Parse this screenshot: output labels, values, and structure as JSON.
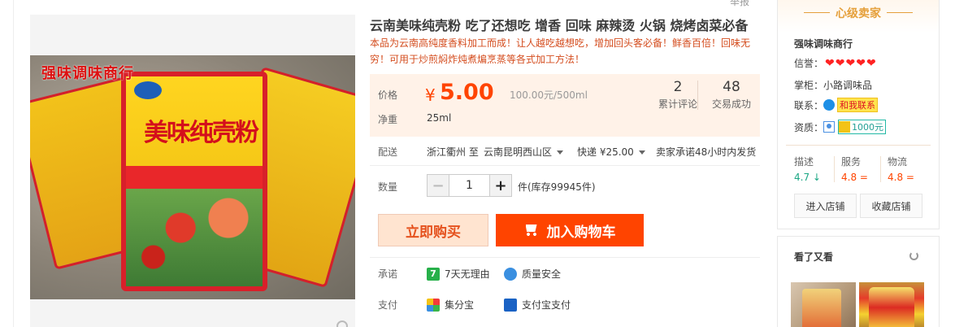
{
  "top": {
    "report_label": "举报"
  },
  "gallery": {
    "watermark": "强味调味商行",
    "pack_title": "美味纯壳粉"
  },
  "product": {
    "title": "云南美味纯壳粉 吃了还想吃 增香 回味 麻辣烫 火锅 烧烤卤菜必备",
    "subtitle": "本品为云南高纯度香料加工而成！让人越吃越想吃，增加回头客必备！鲜香百倍！回味无穷！可用于炒煎焖炸炖煮煸烹蒸等各式加工方法！"
  },
  "price_panel": {
    "price_label": "价格",
    "currency_symbol": "¥",
    "price": "5.00",
    "ref_price": "100.00元/500ml",
    "reviews_count": "2",
    "reviews_label": "累计评论",
    "sales_count": "48",
    "sales_label": "交易成功",
    "net_label": "净重",
    "net_value": "25ml"
  },
  "shipping": {
    "label": "配送",
    "from": "浙江衢州 至",
    "to": "云南昆明西山区",
    "method": "快递 ¥25.00",
    "promise": "卖家承诺48小时内发货"
  },
  "quantity": {
    "label": "数量",
    "minus": "−",
    "value": "1",
    "plus": "+",
    "stock": "件(库存99945件)"
  },
  "actions": {
    "buy_now": "立即购买",
    "add_to_cart": "加入购物车"
  },
  "promise": {
    "label": "承诺",
    "item1_icon": "7",
    "item1": "7天无理由",
    "item2": "质量安全"
  },
  "payment": {
    "label": "支付",
    "item1": "集分宝",
    "item2": "支付宝支付"
  },
  "seller": {
    "level": "心级卖家",
    "shop_name": "强味调味商行",
    "credit_label": "信誉：",
    "credit_hearts": 5,
    "keeper_label": "掌柜：",
    "keeper_name": "小路调味品",
    "contact_label": "联系：",
    "contact_text": "和我联系",
    "qual_label": "资质：",
    "deposit": "1000元",
    "scores": [
      {
        "label": "描述",
        "value": "4.7",
        "trend": "↓"
      },
      {
        "label": "服务",
        "value": "4.8",
        "trend": "="
      },
      {
        "label": "物流",
        "value": "4.8",
        "trend": "="
      }
    ],
    "enter_shop": "进入店铺",
    "fav_shop": "收藏店铺"
  },
  "also_viewed": {
    "title": "看了又看"
  },
  "colors": {
    "accent": "#ff4400",
    "seller_gold": "#e5a03b",
    "panel_bg": "#fff2e8"
  }
}
